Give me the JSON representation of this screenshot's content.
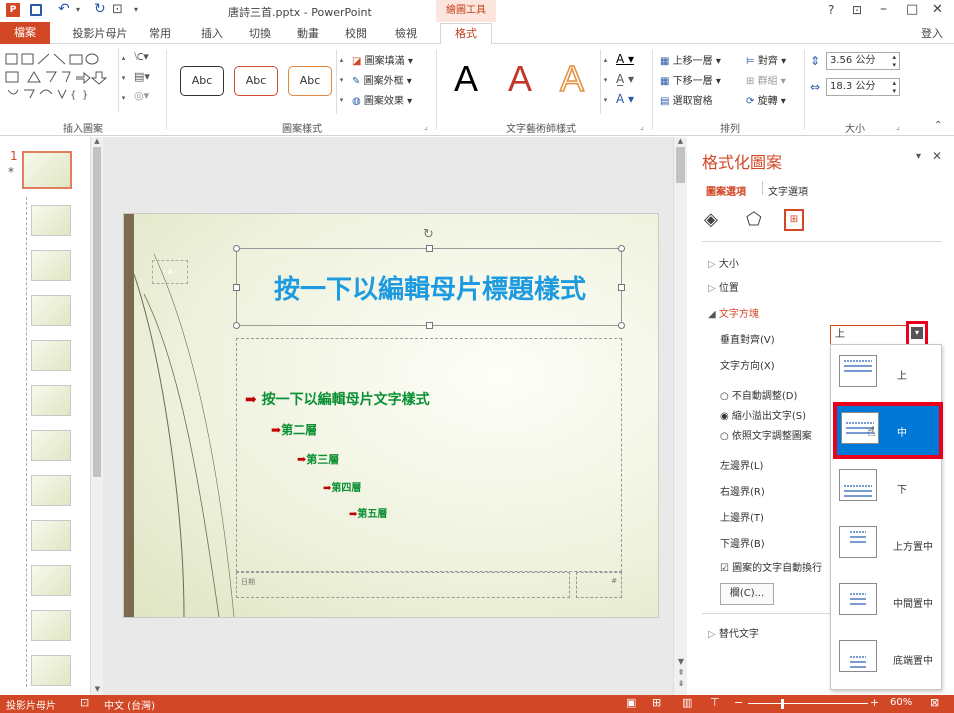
{
  "title_bar": {
    "file_title": "唐詩三首.pptx - PowerPoint",
    "context_tab": "繪圖工具",
    "window_controls": [
      "?",
      "⊡",
      "–",
      "□",
      "✕"
    ]
  },
  "tabs": [
    {
      "label": "檔案"
    },
    {
      "label": "投影片母片"
    },
    {
      "label": "常用"
    },
    {
      "label": "插入"
    },
    {
      "label": "切換"
    },
    {
      "label": "動畫"
    },
    {
      "label": "校閱"
    },
    {
      "label": "檢視"
    },
    {
      "label": "格式"
    }
  ],
  "signin": "登入",
  "ribbon": {
    "insert_shapes": {
      "label": "插入圖案"
    },
    "shape_styles": {
      "label": "圖案樣式",
      "style_sample": "Abc",
      "fill": "圖案填滿",
      "outline": "圖案外框",
      "effects": "圖案效果"
    },
    "wordart": {
      "label": "文字藝術師樣式",
      "letter": "A"
    },
    "arrange": {
      "label": "排列",
      "bring_forward": "上移一層",
      "send_backward": "下移一層",
      "selection_pane": "選取窗格",
      "align": "對齊",
      "group": "群組",
      "rotate": "旋轉"
    },
    "size": {
      "label": "大小",
      "height": "3.56 公分",
      "width": "18.3 公分"
    }
  },
  "slides_panel": {
    "slide_number": "1",
    "star": "*"
  },
  "slide": {
    "title": "按一下以編輯母片標題樣式",
    "level1": "按一下以編輯母片文字樣式",
    "level2": "第二層",
    "level3": "第三層",
    "level4": "第四層",
    "level5": "第五層",
    "date_placeholder": "日期",
    "footer_number": "#"
  },
  "format_pane": {
    "title": "格式化圖案",
    "tab_shape": "圖案選項",
    "tab_text": "文字選項",
    "size": "大小",
    "position": "位置",
    "text_box": "文字方塊",
    "vertical_align": "垂直對齊(V)",
    "vertical_align_value": "上",
    "text_direction": "文字方向(X)",
    "no_autofit": "不自動調整(D)",
    "shrink_overflow": "縮小溢出文字(S)",
    "resize_shape": "依照文字調整圖案",
    "left_margin": "左邊界(L)",
    "right_margin": "右邊界(R)",
    "top_margin": "上邊界(T)",
    "bottom_margin": "下邊界(B)",
    "wrap_text": "圖案的文字自動換行",
    "columns_button": "欄(C)...",
    "alt_text": "替代文字"
  },
  "dropdown": {
    "options": [
      {
        "label": "上"
      },
      {
        "label": "中"
      },
      {
        "label": "下"
      },
      {
        "label": "上方置中"
      },
      {
        "label": "中間置中"
      },
      {
        "label": "底端置中"
      }
    ]
  },
  "status": {
    "view": "投影片母片",
    "language": "中文 (台灣)",
    "zoom": "60%",
    "zoom_fraction": 0.6
  },
  "colors": {
    "accent": "#d24726",
    "highlight": "#0078d7",
    "title_text": "#1e9be0",
    "body_text": "#0a8f33",
    "bullet": "#c00000"
  }
}
